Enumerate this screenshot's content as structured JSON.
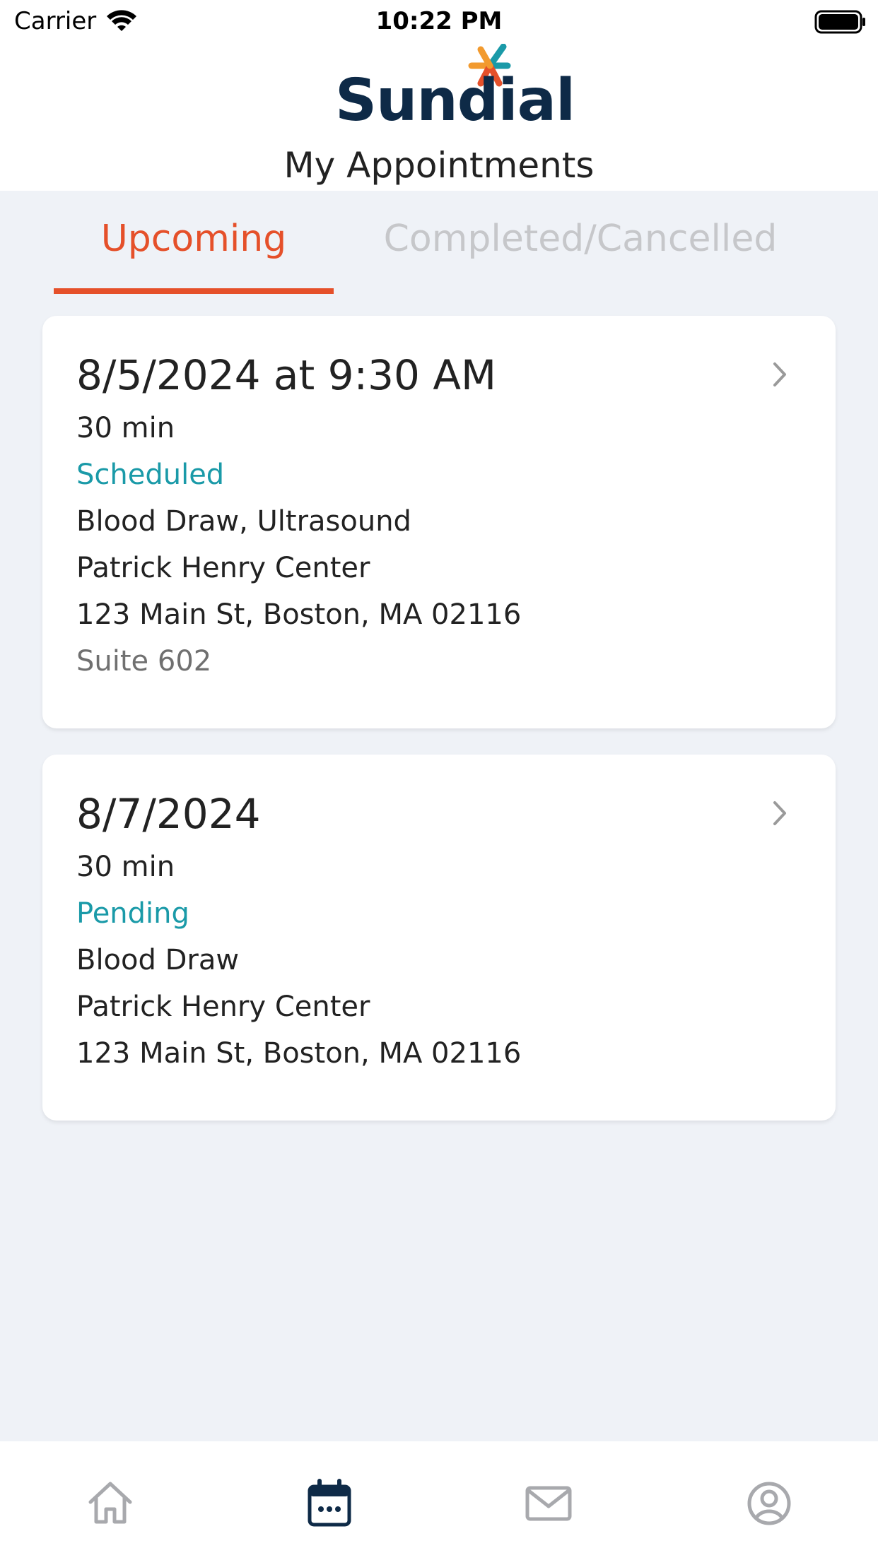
{
  "status_bar": {
    "carrier": "Carrier",
    "time": "10:22 PM"
  },
  "header": {
    "logo_text": "Sundial",
    "title": "My Appointments"
  },
  "tabs": [
    {
      "label": "Upcoming",
      "active": true
    },
    {
      "label": "Completed/Cancelled",
      "active": false
    }
  ],
  "appointments": [
    {
      "datetime": "8/5/2024 at 9:30 AM",
      "duration": "30 min",
      "status": "Scheduled",
      "services": "Blood Draw, Ultrasound",
      "location": "Patrick Henry Center",
      "address": "123 Main St, Boston, MA 02116",
      "suite": "Suite 602"
    },
    {
      "datetime": "8/7/2024",
      "duration": "30 min",
      "status": "Pending",
      "services": "Blood Draw",
      "location": "Patrick Henry Center",
      "address": "123 Main St, Boston, MA 02116"
    }
  ],
  "bottom_nav": [
    {
      "icon": "home-icon",
      "active": false
    },
    {
      "icon": "calendar-icon",
      "active": true
    },
    {
      "icon": "mail-icon",
      "active": false
    },
    {
      "icon": "profile-icon",
      "active": false
    }
  ],
  "colors": {
    "accent": "#e5502a",
    "status": "#1a9aa8",
    "brand_navy": "#0e2a47",
    "background": "#eff2f7"
  }
}
